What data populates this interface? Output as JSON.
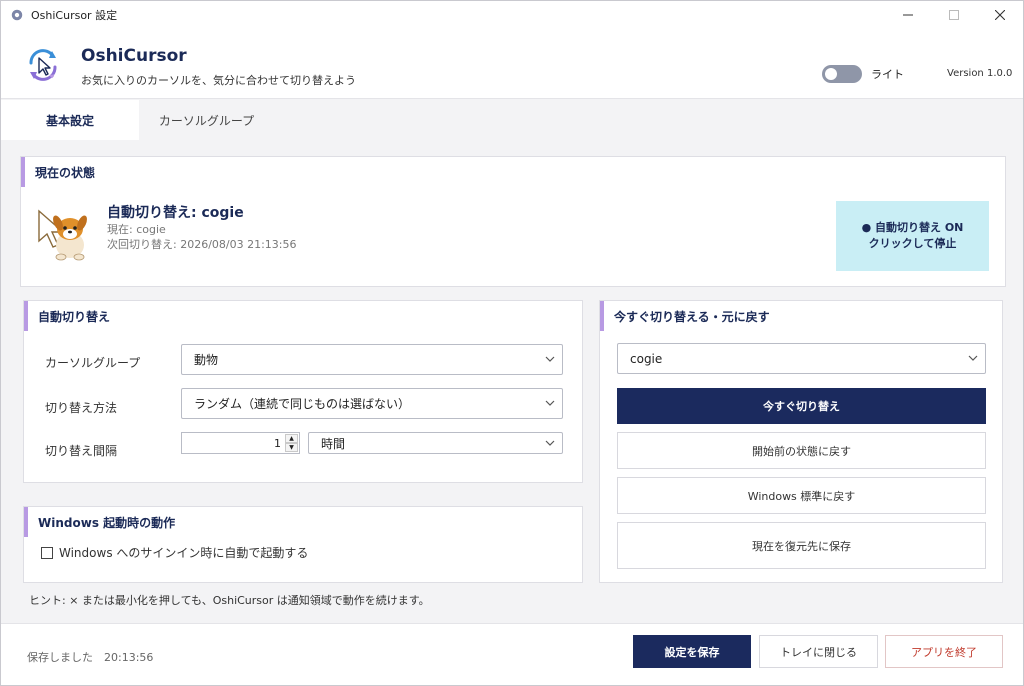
{
  "window": {
    "title": "OshiCursor 設定",
    "icons": {
      "app": "gear-icon",
      "minimize": "minimize-icon",
      "maximize": "maximize-icon",
      "close": "close-icon"
    }
  },
  "header": {
    "app_name": "OshiCursor",
    "subtitle": "お気に入りのカーソルを、気分に合わせて切り替えよう",
    "theme_label": "ライト",
    "theme_toggle_on": false,
    "version": "Version 1.0.0"
  },
  "tabs": [
    {
      "label": "基本設定",
      "active": true
    },
    {
      "label": "カーソルグループ",
      "active": false
    }
  ],
  "status": {
    "title": "現在の状態",
    "main": "自動切り替え: cogie",
    "current": "現在: cogie",
    "next": "次回切り替え: 2026/08/03 21:13:56",
    "button_line1": "● 自動切り替え ON",
    "button_line2": "クリックして停止"
  },
  "auto_switch": {
    "title": "自動切り替え",
    "group_label": "カーソルグループ",
    "group_value": "動物",
    "method_label": "切り替え方法",
    "method_value": "ランダム（連続で同じものは選ばない）",
    "interval_label": "切り替え間隔",
    "interval_value": "1",
    "interval_unit": "時間"
  },
  "startup": {
    "title": "Windows 起動時の動作",
    "checkbox_label": "Windows へのサインイン時に自動で起動する",
    "checked": false
  },
  "switch_now": {
    "title": "今すぐ切り替える・元に戻す",
    "cursor_value": "cogie",
    "switch_now_label": "今すぐ切り替え",
    "restore_before_label": "開始前の状態に戻す",
    "restore_windows_label": "Windows 標準に戻す",
    "save_restore_label": "現在を復元先に保存"
  },
  "hint": "ヒント: × または最小化を押しても、OshiCursor は通知領域で動作を続けます。",
  "footer": {
    "saved_text": "保存しました　20:13:56",
    "save_label": "設定を保存",
    "close_to_tray_label": "トレイに閉じる",
    "quit_label": "アプリを終了"
  },
  "colors": {
    "accent": "#1b2a5e",
    "panel_bar": "#b89ae3",
    "status_button_bg": "#c9eef5",
    "danger": "#c0392b"
  }
}
